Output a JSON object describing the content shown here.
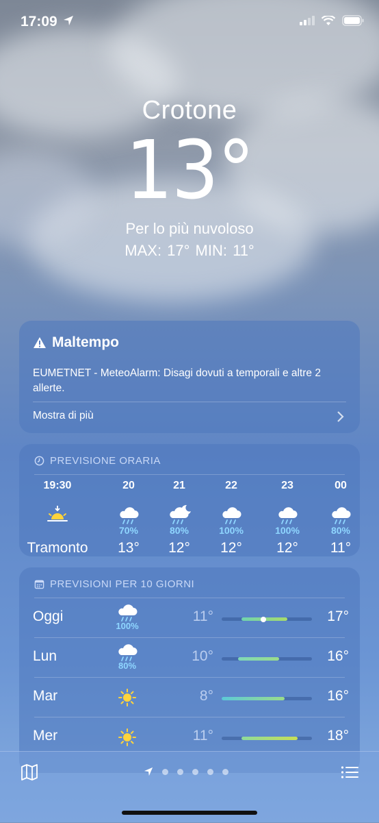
{
  "status": {
    "time": "17:09"
  },
  "hero": {
    "city": "Crotone",
    "temp": "13°",
    "condition": "Per lo più nuvoloso",
    "hilo": "MAX: 17°  MIN: 11°"
  },
  "alert": {
    "title": "Maltempo",
    "body": "EUMETNET - MeteoAlarm: Disagi dovuti a temporali e altre 2 allerte.",
    "more": "Mostra di più"
  },
  "hourly": {
    "title": "PREVISIONE ORARIA",
    "items": [
      {
        "time": "19:30",
        "icon": "sunset-icon",
        "pct": "",
        "temp": "Tramonto"
      },
      {
        "time": "20",
        "icon": "cloud-rain-icon",
        "pct": "70%",
        "temp": "13°"
      },
      {
        "time": "21",
        "icon": "cloud-moon-rain-icon",
        "pct": "80%",
        "temp": "12°"
      },
      {
        "time": "22",
        "icon": "cloud-rain-icon",
        "pct": "100%",
        "temp": "12°"
      },
      {
        "time": "23",
        "icon": "cloud-rain-icon",
        "pct": "100%",
        "temp": "12°"
      },
      {
        "time": "00",
        "icon": "cloud-rain-icon",
        "pct": "80%",
        "temp": "11°"
      }
    ]
  },
  "daily": {
    "title": "PREVISIONI PER 10 GIORNI",
    "items": [
      {
        "day": "Oggi",
        "icon": "cloud-rain-icon",
        "pct": "100%",
        "low": "11°",
        "high": "17°",
        "range_start": 0.22,
        "range_end": 0.73,
        "current": 0.46,
        "colors": [
          "#6fd3b0",
          "#a8dc6a"
        ]
      },
      {
        "day": "Lun",
        "icon": "cloud-rain-icon",
        "pct": "80%",
        "low": "10°",
        "high": "16°",
        "range_start": 0.18,
        "range_end": 0.64,
        "colors": [
          "#7fd8b8",
          "#9bdc8a"
        ]
      },
      {
        "day": "Mar",
        "icon": "sun-icon",
        "pct": "",
        "low": "8°",
        "high": "16°",
        "range_start": 0.0,
        "range_end": 0.7,
        "colors": [
          "#5cc9d8",
          "#9bdc8a"
        ]
      },
      {
        "day": "Mer",
        "icon": "sun-icon",
        "pct": "",
        "low": "11°",
        "high": "18°",
        "range_start": 0.22,
        "range_end": 0.84,
        "colors": [
          "#8edb9c",
          "#c8df55"
        ]
      }
    ]
  },
  "colors": {
    "rain_pct": "#8fd6ff",
    "sun": "#ffd43b"
  }
}
